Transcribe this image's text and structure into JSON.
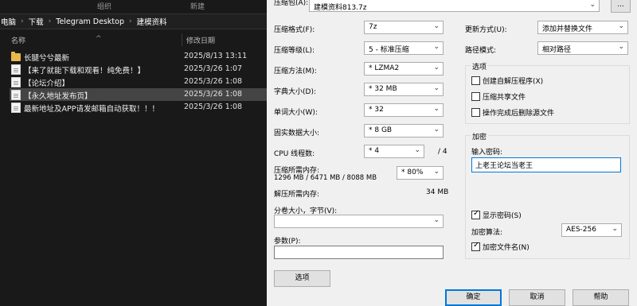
{
  "explorer": {
    "ribbon": {
      "organize": "组织",
      "new": "新建"
    },
    "breadcrumb": [
      "电脑",
      "下载",
      "Telegram Desktop",
      "建模资料"
    ],
    "columns": {
      "name": "名称",
      "modified": "修改日期"
    },
    "files": [
      {
        "name": "长腿兮兮最新",
        "date": "2025/8/13 13:11",
        "icon": "folder-icon"
      },
      {
        "name": "【来了就能下载和观看！纯免费！】",
        "date": "2025/3/26 1:07",
        "icon": "file-icon"
      },
      {
        "name": "【论坛介绍】",
        "date": "2025/3/26 1:08",
        "icon": "file-icon"
      },
      {
        "name": "【永久地址发布页】",
        "date": "2025/3/26 1:08",
        "icon": "file-icon"
      },
      {
        "name": "最新地址及APP请发邮箱自动获取！！！",
        "date": "2025/3/26 1:08",
        "icon": "file-icon"
      }
    ]
  },
  "dialog": {
    "archive_label": "压缩包(A):",
    "archive_name": "建模资料813.7z",
    "browse_label": "...",
    "format_label": "压缩格式(F):",
    "format_value": "7z",
    "level_label": "压缩等级(L):",
    "level_value": "5 - 标准压缩",
    "method_label": "压缩方法(M):",
    "method_value": "* LZMA2",
    "dict_label": "字典大小(D):",
    "dict_value": "* 32 MB",
    "word_label": "单词大小(W):",
    "word_value": "* 32",
    "solid_label": "固实数据大小:",
    "solid_value": "* 8 GB",
    "threads_label": "CPU 线程数:",
    "threads_value": "* 4",
    "threads_total": "/ 4",
    "mem_comp_label": "压缩所需内存:",
    "mem_comp_detail": "1296 MB / 6471 MB / 8088 MB",
    "mem_comp_value": "* 80%",
    "mem_decomp_label": "解压所需内存:",
    "mem_decomp_value": "34 MB",
    "split_label": "分卷大小，字节(V):",
    "split_value": "",
    "params_label": "参数(P):",
    "params_value": "",
    "options_button": "选项",
    "update_label": "更新方式(U):",
    "update_value": "添加并替换文件",
    "path_label": "路径模式:",
    "path_value": "相对路径",
    "options_group": "选项",
    "opt_sfx": "创建自解压程序(X)",
    "opt_shared": "压缩共享文件",
    "opt_delete": "操作完成后删除源文件",
    "encrypt_group": "加密",
    "password_label": "输入密码:",
    "password_value": "上老王论坛当老王",
    "show_password": "显示密码(S)",
    "enc_method_label": "加密算法:",
    "enc_method_value": "AES-256",
    "encrypt_names": "加密文件名(N)",
    "ok": "确定",
    "cancel": "取消",
    "help": "帮助"
  }
}
